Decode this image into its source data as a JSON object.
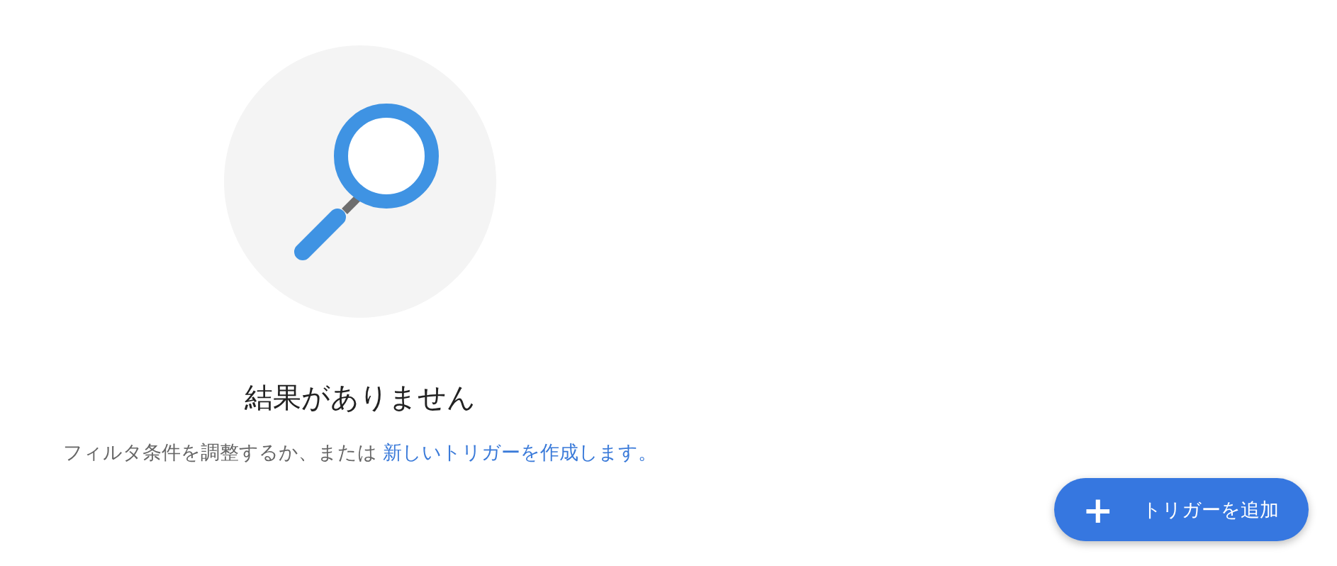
{
  "empty_state": {
    "title": "結果がありません",
    "message": "フィルタ条件を調整するか、または",
    "link": "新しいトリガーを作成します。"
  },
  "fab": {
    "icon": "+",
    "label": "トリガーを追加"
  }
}
